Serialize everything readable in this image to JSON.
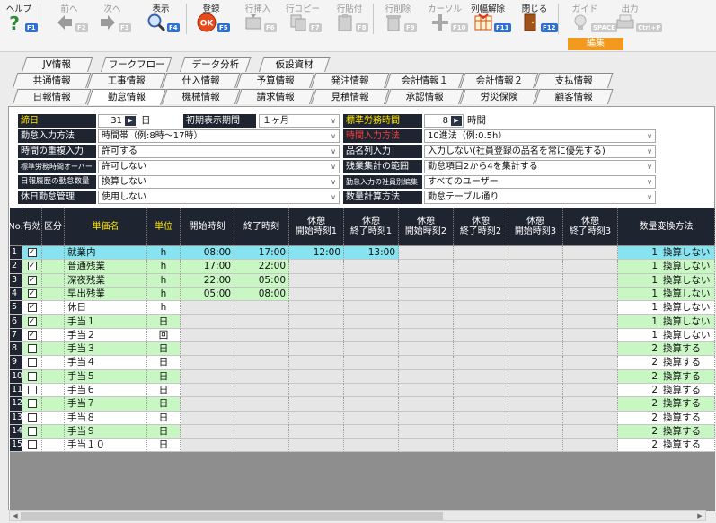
{
  "toolbar": {
    "help": {
      "label": "ヘルプ",
      "key": "F1"
    },
    "prev": {
      "label": "前へ",
      "key": "F2"
    },
    "next": {
      "label": "次へ",
      "key": "F3"
    },
    "display": {
      "label": "表示",
      "key": "F4"
    },
    "register": {
      "label": "登録",
      "key": "F5"
    },
    "row_insert": {
      "label": "行挿入",
      "key": "F6"
    },
    "row_copy": {
      "label": "行コピー",
      "key": "F7"
    },
    "row_paste": {
      "label": "行貼付",
      "key": "F8"
    },
    "row_delete": {
      "label": "行削除",
      "key": "F9"
    },
    "cursor": {
      "label": "カーソル",
      "key": "F10"
    },
    "col_unlock": {
      "label": "列幅解除",
      "key": "F11"
    },
    "close": {
      "label": "閉じる",
      "key": "F12"
    },
    "guide": {
      "label": "ガイド",
      "key": "SPACE"
    },
    "output": {
      "label": "出力",
      "key": "Ctrl+P"
    },
    "edit_label": "編集"
  },
  "tabs": {
    "row1": [
      "JV情報",
      "ワークフロー",
      "データ分析",
      "仮設資材"
    ],
    "row2": [
      "共通情報",
      "工事情報",
      "仕入情報",
      "予算情報",
      "発注情報",
      "会計情報１",
      "会計情報２",
      "支払情報"
    ],
    "row3": [
      "日報情報",
      "勤怠情報",
      "機械情報",
      "請求情報",
      "見積情報",
      "承認情報",
      "労災保険",
      "顧客情報"
    ],
    "active": "勤怠情報"
  },
  "form": {
    "close_day": {
      "label": "締日",
      "value": "31",
      "unit": "日"
    },
    "initial_period": {
      "label": "初期表示期間",
      "value": "１ヶ月"
    },
    "std_hours": {
      "label": "標準労務時間",
      "value": "8",
      "unit": "時間"
    },
    "attend_input": {
      "label": "勤怠入力方法",
      "value": "時間帯（例:8時～17時）"
    },
    "time_input": {
      "label": "時間入力方法",
      "value": "10進法（例:0.5h）"
    },
    "overlap_input": {
      "label": "時間の重複入力",
      "value": "許可する"
    },
    "item_name_input": {
      "label": "品名列入力",
      "value": "入力しない(社員登録の品名を常に優先する)"
    },
    "std_over": {
      "label": "標準労務時間オーバー",
      "value": "許可しない"
    },
    "overtime_range": {
      "label": "残業集計の範囲",
      "value": "勤怠項目2から4を集計する"
    },
    "daily_count": {
      "label": "日報履歴の勤怠数量",
      "value": "換算しない"
    },
    "attend_editor": {
      "label": "勤怠入力の社員別編集",
      "value": "すべてのユーザー"
    },
    "holiday_mgmt": {
      "label": "休日勤怠管理",
      "value": "使用しない"
    },
    "qty_calc": {
      "label": "数量計算方法",
      "value": "勤怠テーブル通り"
    }
  },
  "grid": {
    "headers": [
      "No.",
      "有効",
      "区分",
      "単価名",
      "単位",
      "開始時刻",
      "終了時刻",
      "休憩\n開始時刻1",
      "休憩\n終了時刻1",
      "休憩\n開始時刻2",
      "休憩\n終了時刻2",
      "休憩\n開始時刻3",
      "休憩\n終了時刻3",
      "数量変換方法"
    ],
    "rows": [
      {
        "no": "1",
        "checked": true,
        "name": "就業内",
        "unit": "h",
        "start": "08:00",
        "end": "17:00",
        "b1s": "12:00",
        "b1e": "13:00",
        "conv": "1",
        "method": "換算しない"
      },
      {
        "no": "2",
        "checked": true,
        "name": "普通残業",
        "unit": "h",
        "start": "17:00",
        "end": "22:00",
        "b1s": "",
        "b1e": "",
        "conv": "1",
        "method": "換算しない"
      },
      {
        "no": "3",
        "checked": true,
        "name": "深夜残業",
        "unit": "h",
        "start": "22:00",
        "end": "05:00",
        "b1s": "",
        "b1e": "",
        "conv": "1",
        "method": "換算しない"
      },
      {
        "no": "4",
        "checked": true,
        "name": "早出残業",
        "unit": "h",
        "start": "05:00",
        "end": "08:00",
        "b1s": "",
        "b1e": "",
        "conv": "1",
        "method": "換算しない"
      },
      {
        "no": "5",
        "checked": true,
        "name": "休日",
        "unit": "h",
        "start": "",
        "end": "",
        "b1s": "",
        "b1e": "",
        "conv": "1",
        "method": "換算しない"
      },
      {
        "no": "6",
        "checked": true,
        "name": "手当１",
        "unit": "日",
        "start": "",
        "end": "",
        "b1s": "",
        "b1e": "",
        "conv": "1",
        "method": "換算しない"
      },
      {
        "no": "7",
        "checked": true,
        "name": "手当２",
        "unit": "回",
        "start": "",
        "end": "",
        "b1s": "",
        "b1e": "",
        "conv": "1",
        "method": "換算しない"
      },
      {
        "no": "8",
        "checked": false,
        "name": "手当３",
        "unit": "日",
        "start": "",
        "end": "",
        "b1s": "",
        "b1e": "",
        "conv": "2",
        "method": "換算する"
      },
      {
        "no": "9",
        "checked": false,
        "name": "手当４",
        "unit": "日",
        "start": "",
        "end": "",
        "b1s": "",
        "b1e": "",
        "conv": "2",
        "method": "換算する"
      },
      {
        "no": "10",
        "checked": false,
        "name": "手当５",
        "unit": "日",
        "start": "",
        "end": "",
        "b1s": "",
        "b1e": "",
        "conv": "2",
        "method": "換算する"
      },
      {
        "no": "11",
        "checked": false,
        "name": "手当６",
        "unit": "日",
        "start": "",
        "end": "",
        "b1s": "",
        "b1e": "",
        "conv": "2",
        "method": "換算する"
      },
      {
        "no": "12",
        "checked": false,
        "name": "手当７",
        "unit": "日",
        "start": "",
        "end": "",
        "b1s": "",
        "b1e": "",
        "conv": "2",
        "method": "換算する"
      },
      {
        "no": "13",
        "checked": false,
        "name": "手当８",
        "unit": "日",
        "start": "",
        "end": "",
        "b1s": "",
        "b1e": "",
        "conv": "2",
        "method": "換算する"
      },
      {
        "no": "14",
        "checked": false,
        "name": "手当９",
        "unit": "日",
        "start": "",
        "end": "",
        "b1s": "",
        "b1e": "",
        "conv": "2",
        "method": "換算する"
      },
      {
        "no": "15",
        "checked": false,
        "name": "手当１０",
        "unit": "日",
        "start": "",
        "end": "",
        "b1s": "",
        "b1e": "",
        "conv": "2",
        "method": "換算する"
      }
    ]
  },
  "colors": {
    "selected": "#86e3ef",
    "green": "#c8f7c4",
    "white": "#ffffff",
    "gray": "#e6e6e6",
    "header": "#1e2430",
    "edit": "#f29a1e"
  }
}
